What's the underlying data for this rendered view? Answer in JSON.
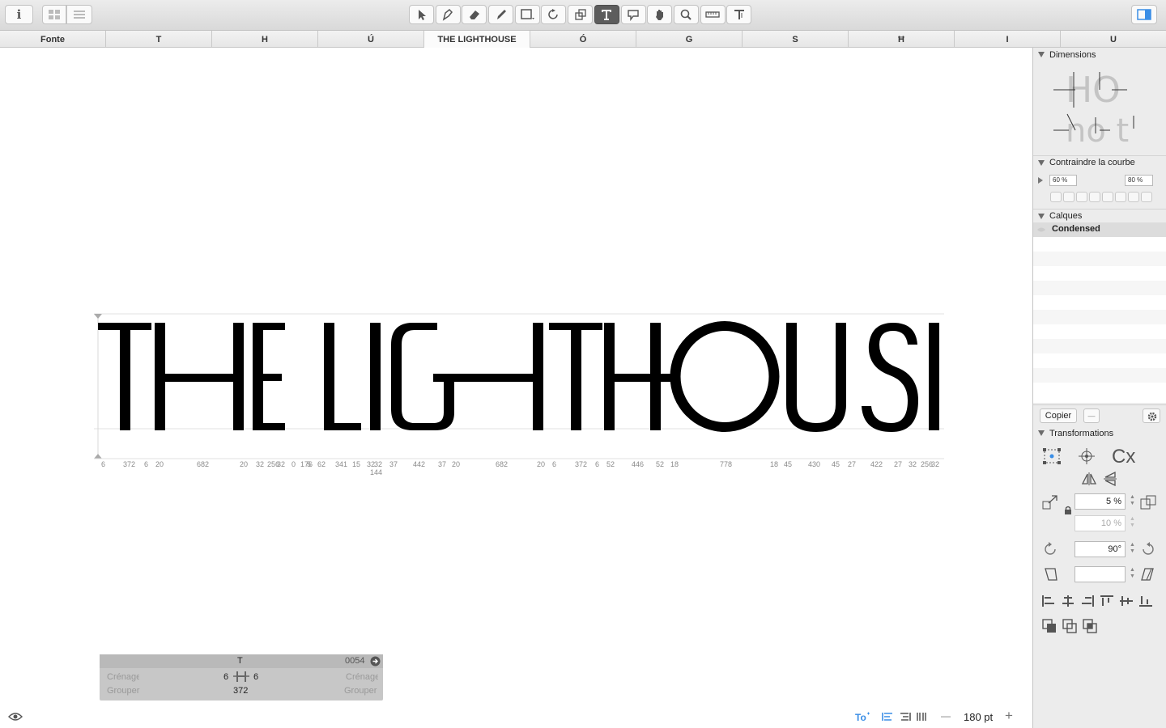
{
  "toolbar": {
    "info_label": "i",
    "accent": "#3a8ee6",
    "tools": [
      {
        "name": "select-tool-icon",
        "label": "Select",
        "active": false
      },
      {
        "name": "pen-tool-icon",
        "label": "Pen",
        "active": false
      },
      {
        "name": "eraser-tool-icon",
        "label": "Eraser",
        "active": false
      },
      {
        "name": "pencil-tool-icon",
        "label": "Pencil",
        "active": false
      },
      {
        "name": "rectangle-tool-icon",
        "label": "Rectangle",
        "active": false
      },
      {
        "name": "rotate-tool-icon",
        "label": "Rotate",
        "active": false
      },
      {
        "name": "scale-tool-icon",
        "label": "Scale",
        "active": false
      },
      {
        "name": "text-tool-icon",
        "label": "T",
        "active": true
      },
      {
        "name": "annotation-tool-icon",
        "label": "Annotation",
        "active": false
      },
      {
        "name": "hand-tool-icon",
        "label": "Hand",
        "active": false
      },
      {
        "name": "zoom-tool-icon",
        "label": "Zoom",
        "active": false
      },
      {
        "name": "ruler-tool-icon",
        "label": "Ruler",
        "active": false
      },
      {
        "name": "measure-tool-icon",
        "label": "Measure",
        "active": false
      }
    ]
  },
  "tabs": [
    "Fonte",
    "T",
    "H",
    "Ú",
    "THE LIGHTHOUSE",
    "Ó",
    "G",
    "S",
    "Ħ",
    "I",
    "U"
  ],
  "canvas": {
    "preview_text": "THE LIGHTHOUSE",
    "metrics": [
      {
        "t": "6"
      },
      {
        "t": "372"
      },
      {
        "t": "6"
      },
      {
        "t": "20"
      },
      {
        "t": "682"
      },
      {
        "t": "20"
      },
      {
        "t": "32"
      },
      {
        "t": "256"
      },
      {
        "t": "32"
      },
      {
        "t": "0"
      },
      {
        "t": "176"
      },
      {
        "t": "5"
      },
      {
        "t": "62"
      },
      {
        "t": "341"
      },
      {
        "t": "15"
      },
      {
        "t": "32"
      },
      {
        "t": "32"
      },
      {
        "t": "37"
      },
      {
        "t": "442"
      },
      {
        "t": "37"
      },
      {
        "t": "20"
      },
      {
        "t": "682"
      },
      {
        "t": "20"
      },
      {
        "t": "6"
      },
      {
        "t": "372"
      },
      {
        "t": "6"
      },
      {
        "t": "52"
      },
      {
        "t": "446"
      },
      {
        "t": "52"
      },
      {
        "t": "18"
      },
      {
        "t": "778"
      },
      {
        "t": "18"
      },
      {
        "t": "45"
      },
      {
        "t": "430"
      },
      {
        "t": "45"
      },
      {
        "t": "27"
      },
      {
        "t": "422"
      },
      {
        "t": "27"
      },
      {
        "t": "32"
      },
      {
        "t": "256"
      },
      {
        "t": "32"
      },
      {
        "t": "144"
      }
    ]
  },
  "info_panel": {
    "glyph": "T",
    "code": "0054",
    "left_kern_label": "Crénage",
    "right_kern_label": "Crénage",
    "left_group_label": "Grouper",
    "right_group_label": "Grouper",
    "left_value": "6",
    "right_value": "6",
    "width_value": "372"
  },
  "bottom": {
    "size_value": "180 pt",
    "minus": "—",
    "plus": "+"
  },
  "sidebar": {
    "dimensions_title": "Dimensions",
    "dim_sample_top": "HO",
    "dim_sample_bottom": "no t",
    "curve_title": "Contraindre la courbe",
    "curve_left": "60 %",
    "curve_right": "80 %",
    "layers_title": "Calques",
    "layer_name": "Condensed",
    "copy_button": "Copier",
    "minus_button": "—",
    "transforms_title": "Transformations",
    "cx_label": "Cx",
    "scale_x": "5 %",
    "scale_y": "10 %",
    "rotate": "90°",
    "slant": ""
  }
}
